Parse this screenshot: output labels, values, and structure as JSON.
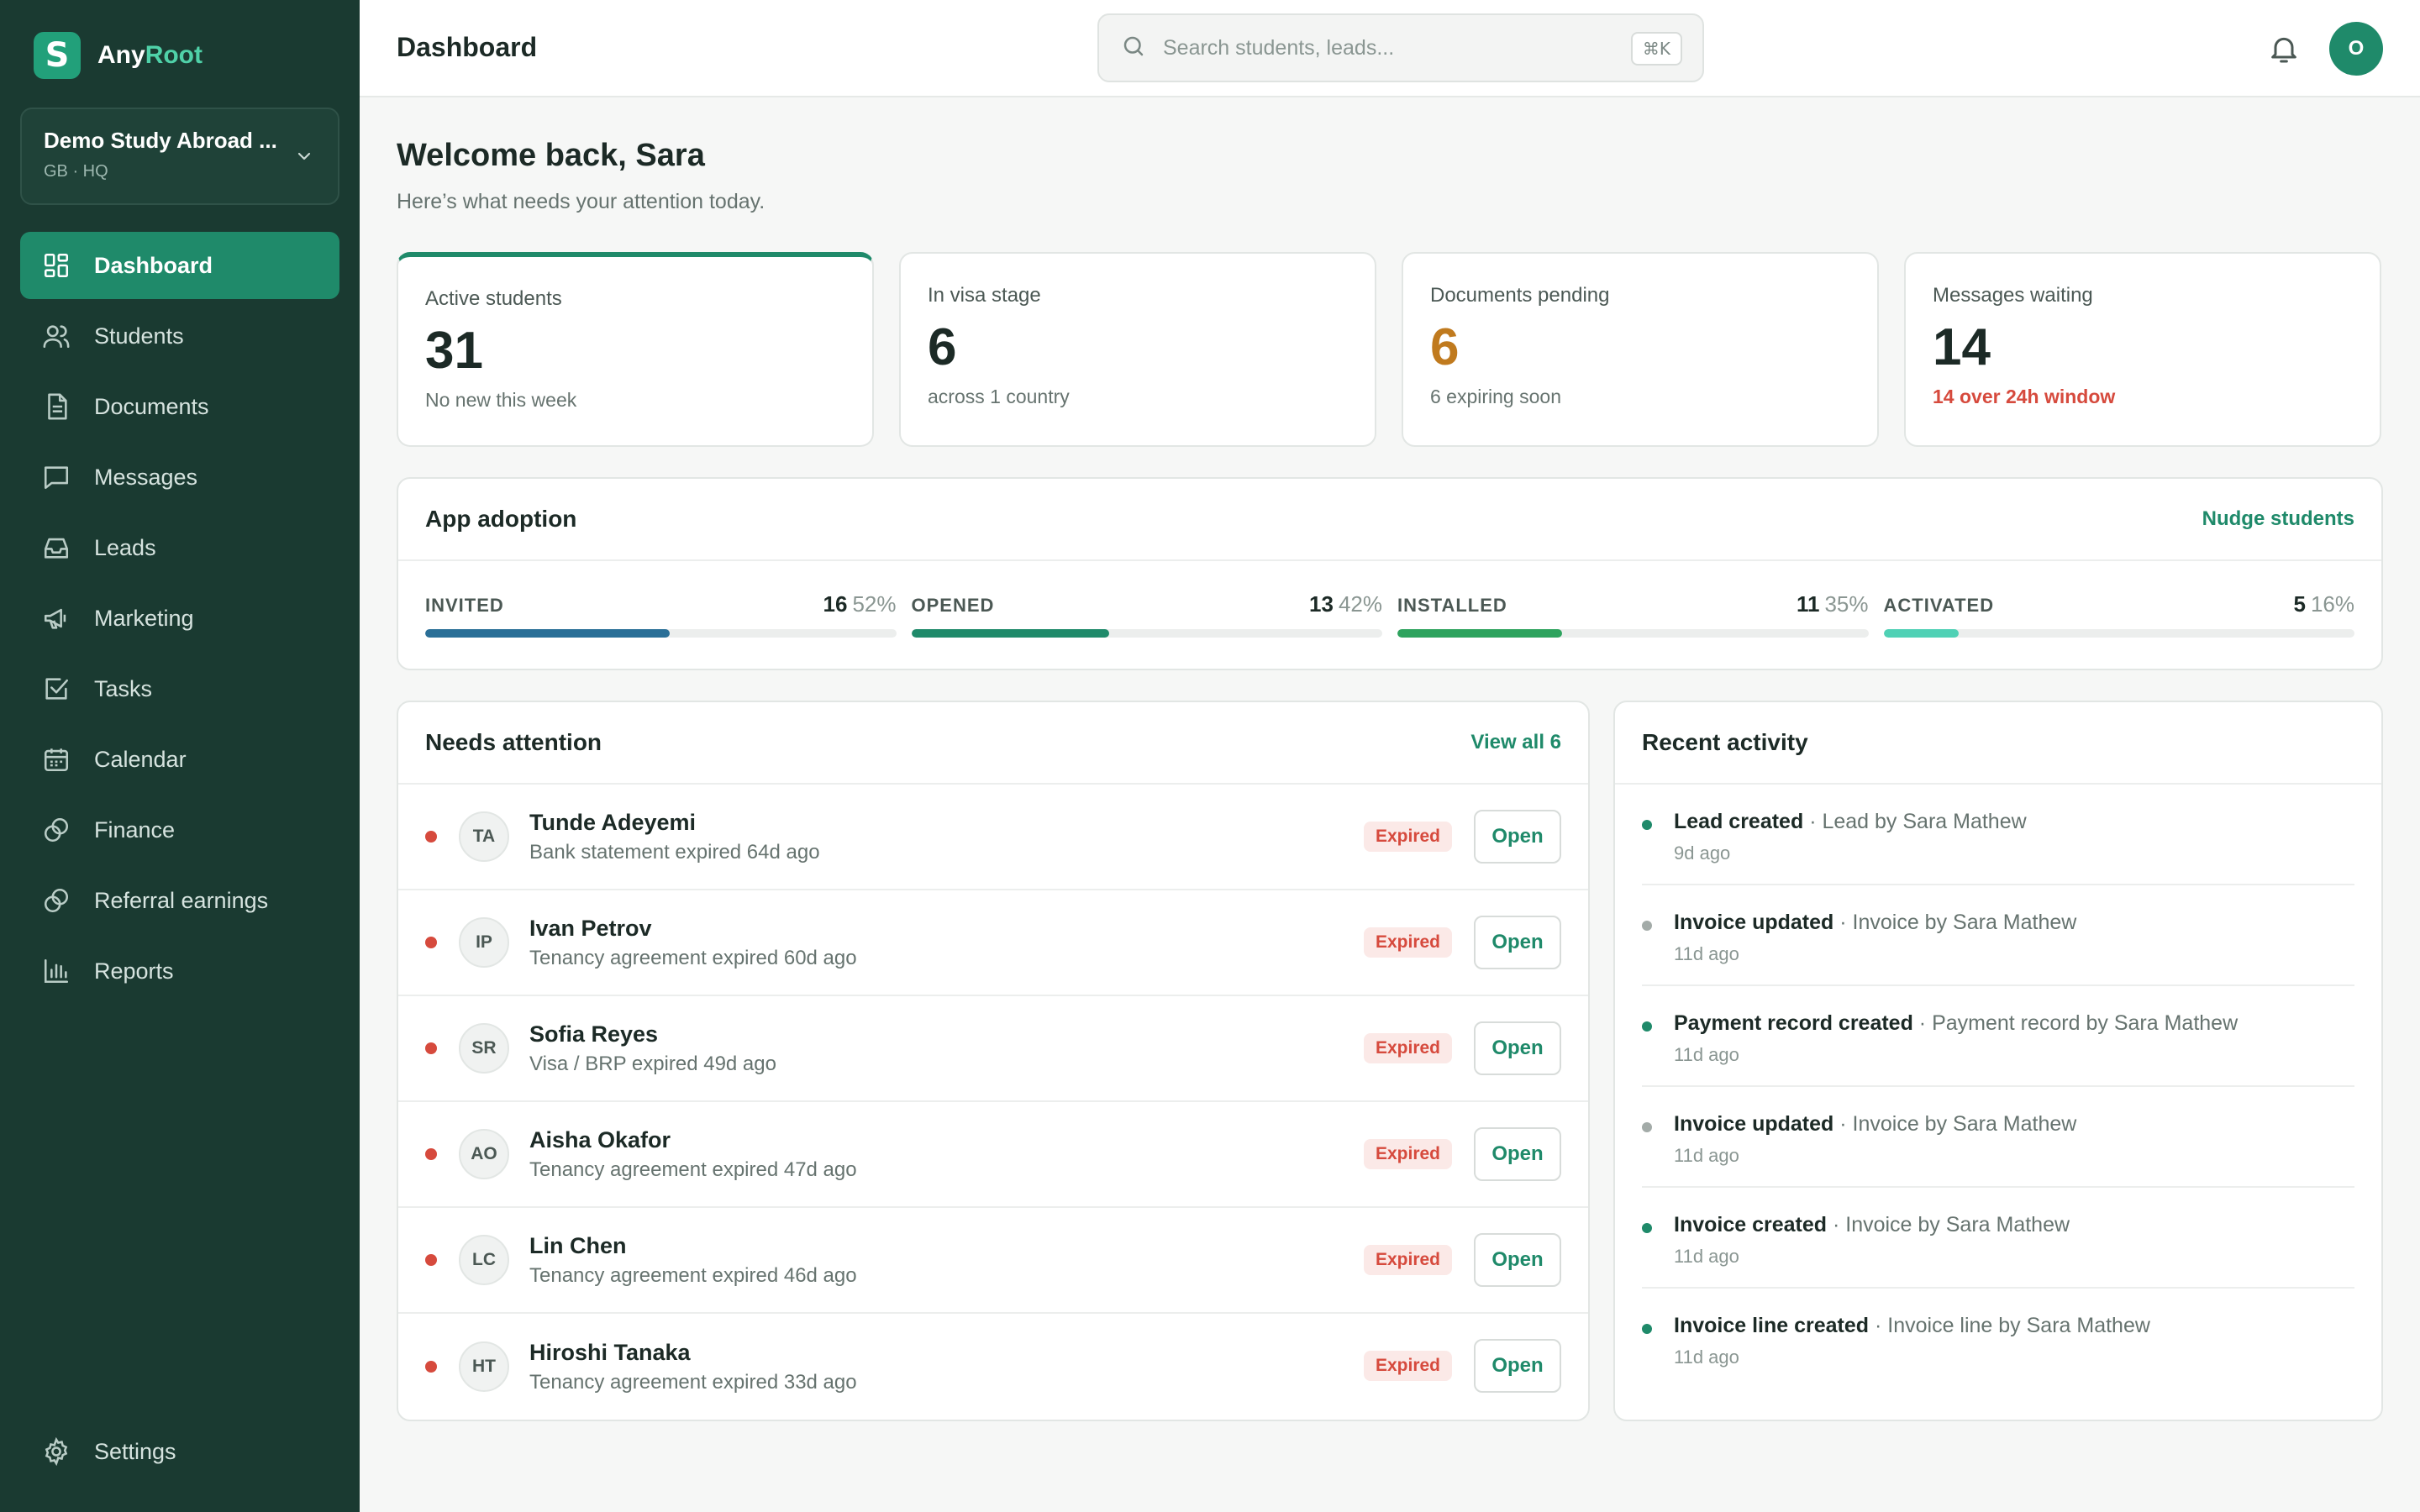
{
  "brand": {
    "name_a": "Any",
    "name_b": "Root",
    "logo_letter": "S"
  },
  "org": {
    "name": "Demo Study Abroad ...",
    "sub": "GB · HQ"
  },
  "nav": [
    {
      "label": "Dashboard",
      "icon": "grid-icon",
      "active": true
    },
    {
      "label": "Students",
      "icon": "users-icon"
    },
    {
      "label": "Documents",
      "icon": "document-icon"
    },
    {
      "label": "Messages",
      "icon": "message-icon"
    },
    {
      "label": "Leads",
      "icon": "inbox-icon"
    },
    {
      "label": "Marketing",
      "icon": "megaphone-icon"
    },
    {
      "label": "Tasks",
      "icon": "checkbox-icon"
    },
    {
      "label": "Calendar",
      "icon": "calendar-icon"
    },
    {
      "label": "Finance",
      "icon": "coins-icon"
    },
    {
      "label": "Referral earnings",
      "icon": "coins-icon"
    },
    {
      "label": "Reports",
      "icon": "bar-chart-icon"
    }
  ],
  "settings_label": "Settings",
  "header": {
    "title": "Dashboard",
    "search_placeholder": "Search students, leads...",
    "search_shortcut": "⌘K",
    "avatar_initial": "O"
  },
  "welcome": {
    "title": "Welcome back, Sara",
    "subtitle": "Here’s what needs your attention today."
  },
  "stats": [
    {
      "label": "Active students",
      "value": "31",
      "sub": "No new this week"
    },
    {
      "label": "In visa stage",
      "value": "6",
      "sub": "across 1 country"
    },
    {
      "label": "Documents pending",
      "value": "6",
      "sub": "6 expiring soon"
    },
    {
      "label": "Messages waiting",
      "value": "14",
      "sub": "14 over 24h window"
    }
  ],
  "adoption": {
    "title": "App adoption",
    "action": "Nudge students",
    "stages": [
      {
        "label": "INVITED",
        "count": "16",
        "pct": "52%",
        "fraction": 0.52,
        "color": "#2a6f97"
      },
      {
        "label": "OPENED",
        "count": "13",
        "pct": "42%",
        "fraction": 0.42,
        "color": "#1f8a6a"
      },
      {
        "label": "INSTALLED",
        "count": "11",
        "pct": "35%",
        "fraction": 0.35,
        "color": "#2ea35e"
      },
      {
        "label": "ACTIVATED",
        "count": "5",
        "pct": "16%",
        "fraction": 0.16,
        "color": "#4fd1b5"
      }
    ]
  },
  "attention": {
    "title": "Needs attention",
    "action": "View all 6",
    "badge": "Expired",
    "button": "Open",
    "rows": [
      {
        "initials": "TA",
        "name": "Tunde Adeyemi",
        "detail": "Bank statement expired 64d ago"
      },
      {
        "initials": "IP",
        "name": "Ivan Petrov",
        "detail": "Tenancy agreement expired 60d ago"
      },
      {
        "initials": "SR",
        "name": "Sofia Reyes",
        "detail": "Visa / BRP expired 49d ago"
      },
      {
        "initials": "AO",
        "name": "Aisha Okafor",
        "detail": "Tenancy agreement expired 47d ago"
      },
      {
        "initials": "LC",
        "name": "Lin Chen",
        "detail": "Tenancy agreement expired 46d ago"
      },
      {
        "initials": "HT",
        "name": "Hiroshi Tanaka",
        "detail": "Tenancy agreement expired 33d ago"
      }
    ]
  },
  "activity": {
    "title": "Recent activity",
    "items": [
      {
        "title": "Lead created",
        "desc": " · Lead by Sara Mathew",
        "time": "9d ago",
        "color": "#1f8a6a"
      },
      {
        "title": "Invoice updated",
        "desc": " · Invoice by Sara Mathew",
        "time": "11d ago",
        "color": "#a3aba8"
      },
      {
        "title": "Payment record created",
        "desc": " · Payment record by Sara Mathew",
        "time": "11d ago",
        "color": "#1f8a6a"
      },
      {
        "title": "Invoice updated",
        "desc": " · Invoice by Sara Mathew",
        "time": "11d ago",
        "color": "#a3aba8"
      },
      {
        "title": "Invoice created",
        "desc": " · Invoice by Sara Mathew",
        "time": "11d ago",
        "color": "#1f8a6a"
      },
      {
        "title": "Invoice line created",
        "desc": " · Invoice line by Sara Mathew",
        "time": "11d ago",
        "color": "#1f8a6a"
      }
    ]
  }
}
